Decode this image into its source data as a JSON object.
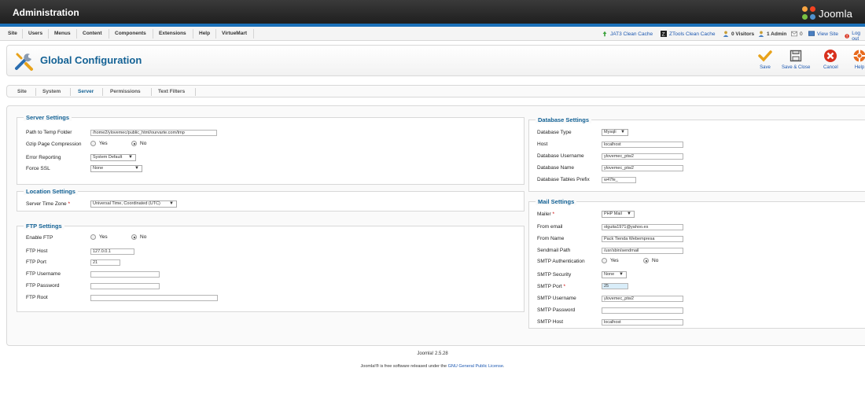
{
  "header": {
    "title": "Administration",
    "logo_text": "Joomla"
  },
  "menu": {
    "items": [
      "Site",
      "Users",
      "Menus",
      "Content",
      "Components",
      "Extensions",
      "Help",
      "VirtueMart"
    ]
  },
  "status": {
    "jat3": "JAT3 Clean Cache",
    "ztools": "ZTools Clean Cache",
    "visitors": "0 Visitors",
    "admin": "1 Admin",
    "messages": "0",
    "view_site": "View Site",
    "logout": "Log out"
  },
  "toolbar": {
    "title": "Global Configuration",
    "save": "Save",
    "save_close": "Save & Close",
    "cancel": "Cancel",
    "help": "Help"
  },
  "tabs": [
    "Site",
    "System",
    "Server",
    "Permissions",
    "Text Filters"
  ],
  "active_tab": "Server",
  "server_settings": {
    "legend": "Server Settings",
    "temp_label": "Path to Temp Folder",
    "temp_value": "/home2/ylovemec/public_html/ourvarte.com/tmp",
    "gzip_label": "Gzip Page Compression",
    "yes": "Yes",
    "no": "No",
    "error_label": "Error Reporting",
    "error_value": "System Default",
    "ssl_label": "Force SSL",
    "ssl_value": "None"
  },
  "location_settings": {
    "legend": "Location Settings",
    "tz_label": "Server Time Zone",
    "req": "*",
    "tz_value": "Universal Time, Coordinated (UTC)"
  },
  "ftp_settings": {
    "legend": "FTP Settings",
    "enable_label": "Enable FTP",
    "yes": "Yes",
    "no": "No",
    "host_label": "FTP Host",
    "host_value": "127.0.0.1",
    "port_label": "FTP Port",
    "port_value": "21",
    "user_label": "FTP Username",
    "user_value": "",
    "pass_label": "FTP Password",
    "pass_value": "",
    "root_label": "FTP Root",
    "root_value": ""
  },
  "database_settings": {
    "legend": "Database Settings",
    "type_label": "Database Type",
    "type_value": "Mysqli",
    "host_label": "Host",
    "host_value": "localhost",
    "user_label": "Database Username",
    "user_value": "ylovemec_ptw2",
    "name_label": "Database Name",
    "name_value": "ylovemec_ptw2",
    "prefix_label": "Database Tables Prefix",
    "prefix_value": "w47fe_"
  },
  "mail_settings": {
    "legend": "Mail Settings",
    "mailer_label": "Mailer",
    "req": "*",
    "mailer_value": "PHP Mail",
    "from_email_label": "From email",
    "from_email_value": "olguita1971@yahoo.es",
    "from_name_label": "From Name",
    "from_name_value": "Pack Tienda Webempresa",
    "sendmail_label": "Sendmail Path",
    "sendmail_value": "/usr/sbin/sendmail",
    "auth_label": "SMTP Authentication",
    "yes": "Yes",
    "no": "No",
    "security_label": "SMTP Security",
    "security_value": "None",
    "port_label": "SMTP Port",
    "port_value": "25",
    "smtp_user_label": "SMTP Username",
    "smtp_user_value": "ylovemec_ptw2",
    "smtp_pass_label": "SMTP Password",
    "smtp_pass_value": "",
    "smtp_host_label": "SMTP Host",
    "smtp_host_value": "localhost"
  },
  "footer": {
    "version": "Joomla! 2.5.28",
    "license_prefix": "Joomla!® is free software released under the ",
    "license_link": "GNU General Public License",
    "license_suffix": "."
  },
  "colors": {
    "header_bg": "#1c1c1c",
    "header_stripe": "#1b70b8",
    "title_blue": "#146295",
    "link_blue": "#1b57b1",
    "save_check": "#e8a21a",
    "cancel_red": "#d8301d",
    "help_orange": "#e86a1d"
  }
}
